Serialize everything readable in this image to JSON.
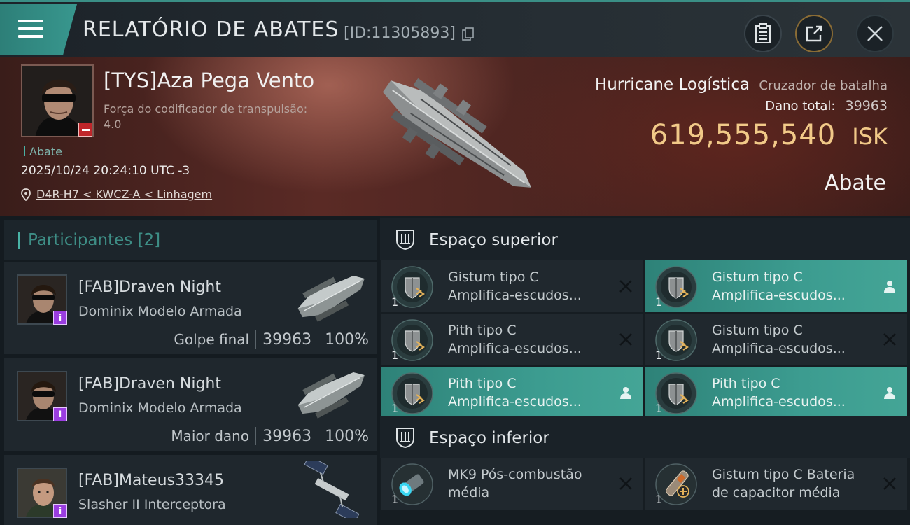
{
  "header": {
    "title": "RELATÓRIO DE ABATES",
    "report_id": "[ID:11305893]"
  },
  "victim": {
    "pilot_name": "[TYS]Aza Pega Vento",
    "stat_label": "Força do codificador de transpulsão:",
    "stat_value": "4.0",
    "kill_tag": "Abate",
    "datetime": "2025/10/24 20:24:10 UTC -3",
    "location": "D4R-H7 < KWCZ-A < Linhagem",
    "ship_name": "Hurricane Logística",
    "ship_class": "Cruzador de batalha",
    "damage_label": "Dano total:",
    "damage_value": "39963",
    "isk_value": "619,555,540",
    "isk_unit": "ISK",
    "kill_type": "Abate"
  },
  "participants": {
    "label": "Participantes",
    "count": "[2]",
    "list": [
      {
        "name": "[FAB]Draven Night",
        "ship": "Dominix Modelo Armada",
        "role": "Golpe final",
        "damage": "39963",
        "percent": "100%"
      },
      {
        "name": "[FAB]Draven Night",
        "ship": "Dominix Modelo Armada",
        "role": "Maior dano",
        "damage": "39963",
        "percent": "100%"
      },
      {
        "name": "[FAB]Mateus33345",
        "ship": "Slasher II Interceptora"
      }
    ]
  },
  "sections": {
    "upper": "Espaço superior",
    "lower": "Espaço inferior"
  },
  "upper_modules": [
    {
      "qty": "1",
      "name": "Gistum tipo C",
      "desc": "Amplifica-escudos...",
      "status": "destroyed"
    },
    {
      "qty": "1",
      "name": "Gistum tipo C",
      "desc": "Amplifica-escudos...",
      "status": "dropped"
    },
    {
      "qty": "1",
      "name": "Pith tipo C",
      "desc": "Amplifica-escudos...",
      "status": "destroyed"
    },
    {
      "qty": "1",
      "name": "Gistum tipo C",
      "desc": "Amplifica-escudos...",
      "status": "destroyed"
    },
    {
      "qty": "1",
      "name": "Pith tipo C",
      "desc": "Amplifica-escudos...",
      "status": "dropped"
    },
    {
      "qty": "1",
      "name": "Pith tipo C",
      "desc": "Amplifica-escudos...",
      "status": "dropped"
    }
  ],
  "lower_modules": [
    {
      "qty": "1",
      "name": "MK9 Pós-combustão",
      "desc": "média",
      "status": "destroyed"
    },
    {
      "qty": "1",
      "name": "Gistum tipo C Bateria",
      "desc": "de capacitor média",
      "status": "destroyed"
    }
  ],
  "icons": {
    "menu": "hamburger-icon",
    "copy": "copy-icon",
    "clipboard": "clipboard-icon",
    "share": "share-icon",
    "close": "close-icon",
    "location": "location-pin-icon",
    "destroyed": "x-icon",
    "dropped": "person-icon"
  },
  "colors": {
    "accent": "#3a9a8f",
    "isk": "#f1c988",
    "kill_badge": "#c0262a",
    "pilot_badge": "#9a3de0"
  }
}
